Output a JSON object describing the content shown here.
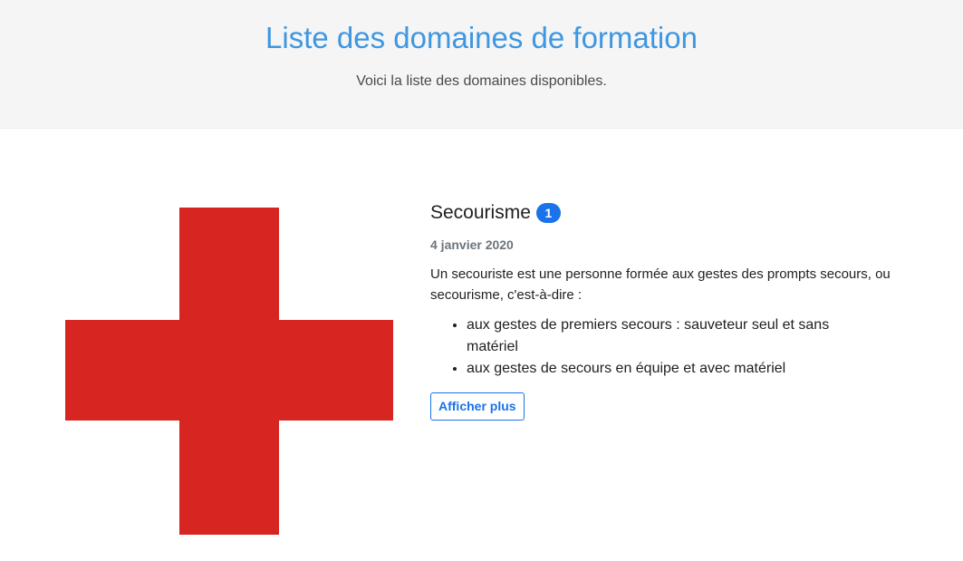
{
  "header": {
    "title": "Liste des domaines de formation",
    "subtitle": "Voici la liste des domaines disponibles."
  },
  "domain_card": {
    "image_icon": "red-cross-icon",
    "image_color": "#d72621",
    "title": "Secourisme",
    "badge_count": "1",
    "date": "4 janvier 2020",
    "description": "Un secouriste est une personne formée aux gestes des prompts secours, ou secourisme, c'est-à-dire :",
    "list_items": [
      "aux gestes de premiers secours : sauveteur seul et sans matériel",
      "aux gestes de secours en équipe et avec matériel"
    ],
    "button_label": "Afficher plus"
  },
  "colors": {
    "accent": "#3e97e0",
    "primary": "#1a73e8",
    "header_bg": "#f5f5f5"
  }
}
